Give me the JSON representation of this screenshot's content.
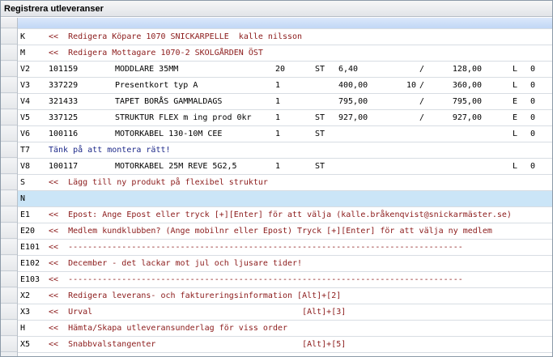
{
  "window": {
    "title": "Registrera utleveranser"
  },
  "rows": [
    {
      "code": "K",
      "text": "<<  Redigera Köpare 1070 SNICKARPELLE  kalle nilsson",
      "style": "red"
    },
    {
      "code": "M",
      "text": "<<  Redigera Mottagare 1070-2 SKOLGÅRDEN ÖST",
      "style": "red"
    },
    {
      "code": "V2",
      "cols": [
        "101159",
        "MODDLARE 35MM",
        "20",
        "ST",
        "6,40",
        "",
        "/",
        "128,00",
        "L",
        "0"
      ]
    },
    {
      "code": "V3",
      "cols": [
        "337229",
        "Presentkort typ A",
        "1",
        "",
        "400,00",
        "10",
        "/",
        "360,00",
        "L",
        "0"
      ]
    },
    {
      "code": "V4",
      "cols": [
        "321433",
        "TAPET BORÅS GAMMALDAGS",
        "1",
        "",
        "795,00",
        "",
        "/",
        "795,00",
        "E",
        "0"
      ]
    },
    {
      "code": "V5",
      "cols": [
        "337125",
        "STRUKTUR FLEX m ing prod 0kr",
        "1",
        "ST",
        "927,00",
        "",
        "/",
        "927,00",
        "E",
        "0"
      ]
    },
    {
      "code": "V6",
      "cols": [
        "100116",
        "MOTORKABEL 130-10M CEE",
        "1",
        "ST",
        "",
        "",
        "",
        "",
        "L",
        "0"
      ]
    },
    {
      "code": "T7",
      "text": "Tänk på att montera rätt!",
      "style": "blue"
    },
    {
      "code": "V8",
      "cols": [
        "100117",
        "MOTORKABEL 25M REVE 5G2,5",
        "1",
        "ST",
        "",
        "",
        "",
        "",
        "L",
        "0"
      ]
    },
    {
      "code": "S",
      "text": "<<  Lägg till ny produkt på flexibel struktur",
      "style": "red"
    },
    {
      "code": "N",
      "text": "",
      "style": "highlight"
    },
    {
      "code": "E1",
      "text": "<<  Epost: Ange Epost eller tryck [+][Enter] för att välja (kalle.bråkenqvist@snickarmäster.se)",
      "style": "red"
    },
    {
      "code": "E20",
      "text": "<<  Medlem kundklubben? (Ange mobilnr eller Epost) Tryck [+][Enter] för att välja ny medlem",
      "style": "red"
    },
    {
      "code": "E101",
      "text": "<<  ---------------------------------------------------------------------------------",
      "style": "red"
    },
    {
      "code": "E102",
      "text": "<<  December - det lackar mot jul och ljusare tider!",
      "style": "red"
    },
    {
      "code": "E103",
      "text": "<<  ---------------------------------------------------------------------------------",
      "style": "red"
    },
    {
      "code": "X2",
      "text": "<<  Redigera leverans- och faktureringsinformation [Alt]+[2]",
      "style": "red"
    },
    {
      "code": "X3",
      "text": "<<  Urval                                           [Alt]+[3]",
      "style": "red"
    },
    {
      "code": "H",
      "text": "<<  Hämta/Skapa utleveransunderlag för viss order",
      "style": "red"
    },
    {
      "code": "X5",
      "text": "<<  Snabbvalstangenter                              [Alt]+[5]",
      "style": "red"
    }
  ]
}
